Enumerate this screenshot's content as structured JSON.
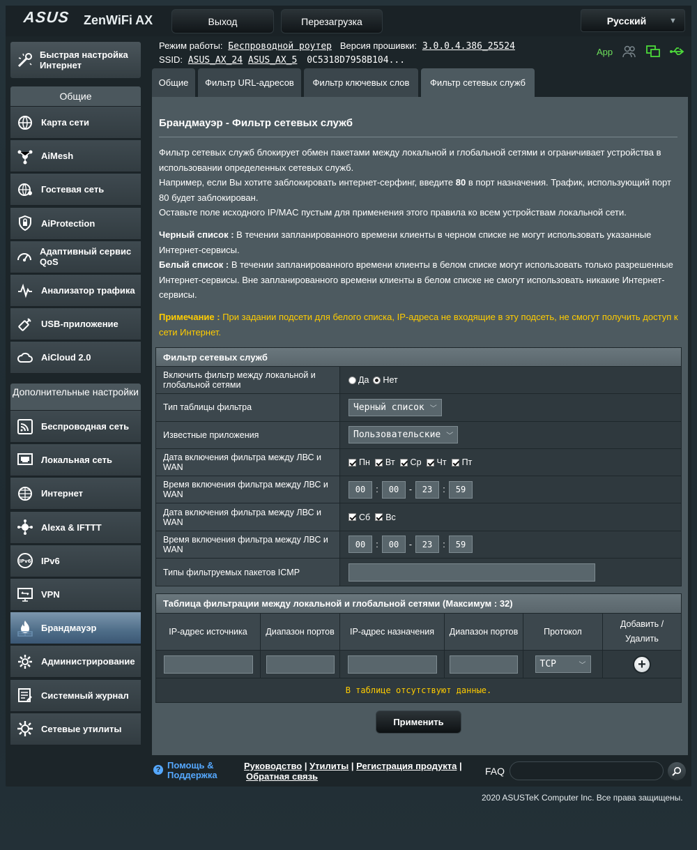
{
  "header": {
    "logo": "ASUS",
    "product": "ZenWiFi AX",
    "logout_label": "Выход",
    "reboot_label": "Перезагрузка",
    "language": "Русский"
  },
  "status": {
    "mode_label": "Режим работы:",
    "mode_value": "Беспроводной роутер",
    "fw_label": "Версия прошивки:",
    "fw_value": "3.0.0.4.386_25524",
    "ssid_label": "SSID:",
    "ssid_1": "ASUS_AX_24",
    "ssid_2": "ASUS_AX_5",
    "ssid_3": "0C5318D7958B104...",
    "app_label": "App"
  },
  "sidebar": {
    "quick_setup": "Быстрая настройка Интернет",
    "general_header": "Общие",
    "general_items": [
      {
        "label": "Карта сети",
        "icon": "network-map-icon"
      },
      {
        "label": "AiMesh",
        "icon": "aimesh-icon"
      },
      {
        "label": "Гостевая сеть",
        "icon": "guest-network-icon"
      },
      {
        "label": "AiProtection",
        "icon": "shield-icon"
      },
      {
        "label": "Адаптивный сервис QoS",
        "icon": "speedometer-icon"
      },
      {
        "label": "Анализатор трафика",
        "icon": "traffic-analyzer-icon"
      },
      {
        "label": "USB-приложение",
        "icon": "usb-icon"
      },
      {
        "label": "AiCloud 2.0",
        "icon": "cloud-icon"
      }
    ],
    "advanced_header": "Дополнительные настройки",
    "advanced_items": [
      {
        "label": "Беспроводная сеть",
        "icon": "wifi-icon"
      },
      {
        "label": "Локальная сеть",
        "icon": "lan-icon"
      },
      {
        "label": "Интернет",
        "icon": "globe-icon"
      },
      {
        "label": "Alexa & IFTTT",
        "icon": "alexa-icon"
      },
      {
        "label": "IPv6",
        "icon": "ipv6-icon"
      },
      {
        "label": "VPN",
        "icon": "vpn-icon"
      },
      {
        "label": "Брандмауэр",
        "icon": "firewall-icon",
        "active": true
      },
      {
        "label": "Администрирование",
        "icon": "admin-gear-icon"
      },
      {
        "label": "Системный журнал",
        "icon": "log-icon"
      },
      {
        "label": "Сетевые утилиты",
        "icon": "tools-icon"
      }
    ]
  },
  "tabs": [
    "Общие",
    "Фильтр URL-адресов",
    "Фильтр ключевых слов",
    "Фильтр сетевых служб"
  ],
  "page": {
    "title": "Брандмауэр - Фильтр сетевых служб",
    "desc1": "Фильтр сетевых служб блокирует обмен пакетами между локальной и глобальной сетями и ограничивает устройства в использовании определенных сетевых служб.",
    "desc2a": "Например, если Вы хотите заблокировать интернет-серфинг, введите ",
    "desc2b": "80",
    "desc2c": " в порт назначения. Трафик, использующий порт 80 будет заблокирован.",
    "desc3": "Оставьте поле исходного IP/MAC пустым для применения этого правила ко всем устройствам локальной сети.",
    "black_label": "Черный список :",
    "black_text": " В течении запланированного времени клиенты в черном списке не могут использовать указанные Интернет-сервисы.",
    "white_label": "Белый список :",
    "white_text": " В течении запланированного времени клиенты в белом списке могут использовать только разрешенные Интернет-сервисы. Вне запланированного времени клиенты в белом списке не смогут использовать никакие Интернет-сервисы.",
    "note_label": "Примечание :",
    "note_text": " При задании подсети для белого списка, IP-адреса не входящие в эту подсеть, не смогут получить доступ к сети Интернет."
  },
  "form": {
    "header": "Фильтр сетевых служб",
    "enable_label": "Включить фильтр между локальной и глобальной сетями",
    "yes": "Да",
    "no": "Нет",
    "table_type_label": "Тип таблицы фильтра",
    "table_type_value": "Черный список",
    "known_apps_label": "Известные приложения",
    "known_apps_value": "Пользовательские",
    "weekday_date_label": "Дата включения фильтра между ЛВС и WAN",
    "weekdays": [
      "Пн",
      "Вт",
      "Ср",
      "Чт",
      "Пт"
    ],
    "weekday_time_label": "Время включения фильтра между ЛВС и WAN",
    "weekday_time": [
      "00",
      "00",
      "23",
      "59"
    ],
    "weekend_date_label": "Дата включения фильтра между ЛВС и WAN",
    "weekend": [
      "Сб",
      "Вс"
    ],
    "weekend_time_label": "Время включения фильтра между ЛВС и WAN",
    "weekend_time": [
      "00",
      "00",
      "23",
      "59"
    ],
    "icmp_label": "Типы фильтруемых пакетов ICMP",
    "icmp_value": ""
  },
  "list": {
    "header": "Таблица фильтрации между локальной и глобальной сетями (Максимум : 32)",
    "cols": [
      "IP-адрес источника",
      "Диапазон портов",
      "IP-адрес назначения",
      "Диапазон портов",
      "Протокол",
      "Добавить / Удалить"
    ],
    "protocol_value": "TCP",
    "empty": "В таблице отсутствуют данные."
  },
  "apply_label": "Применить",
  "footer": {
    "help": "Помощь & Поддержка",
    "links": [
      "Руководство",
      "Утилиты",
      "Регистрация продукта",
      "Обратная связь"
    ],
    "faq": "FAQ",
    "copyright": "2020 ASUSTeK Computer Inc. Все права защищены."
  }
}
